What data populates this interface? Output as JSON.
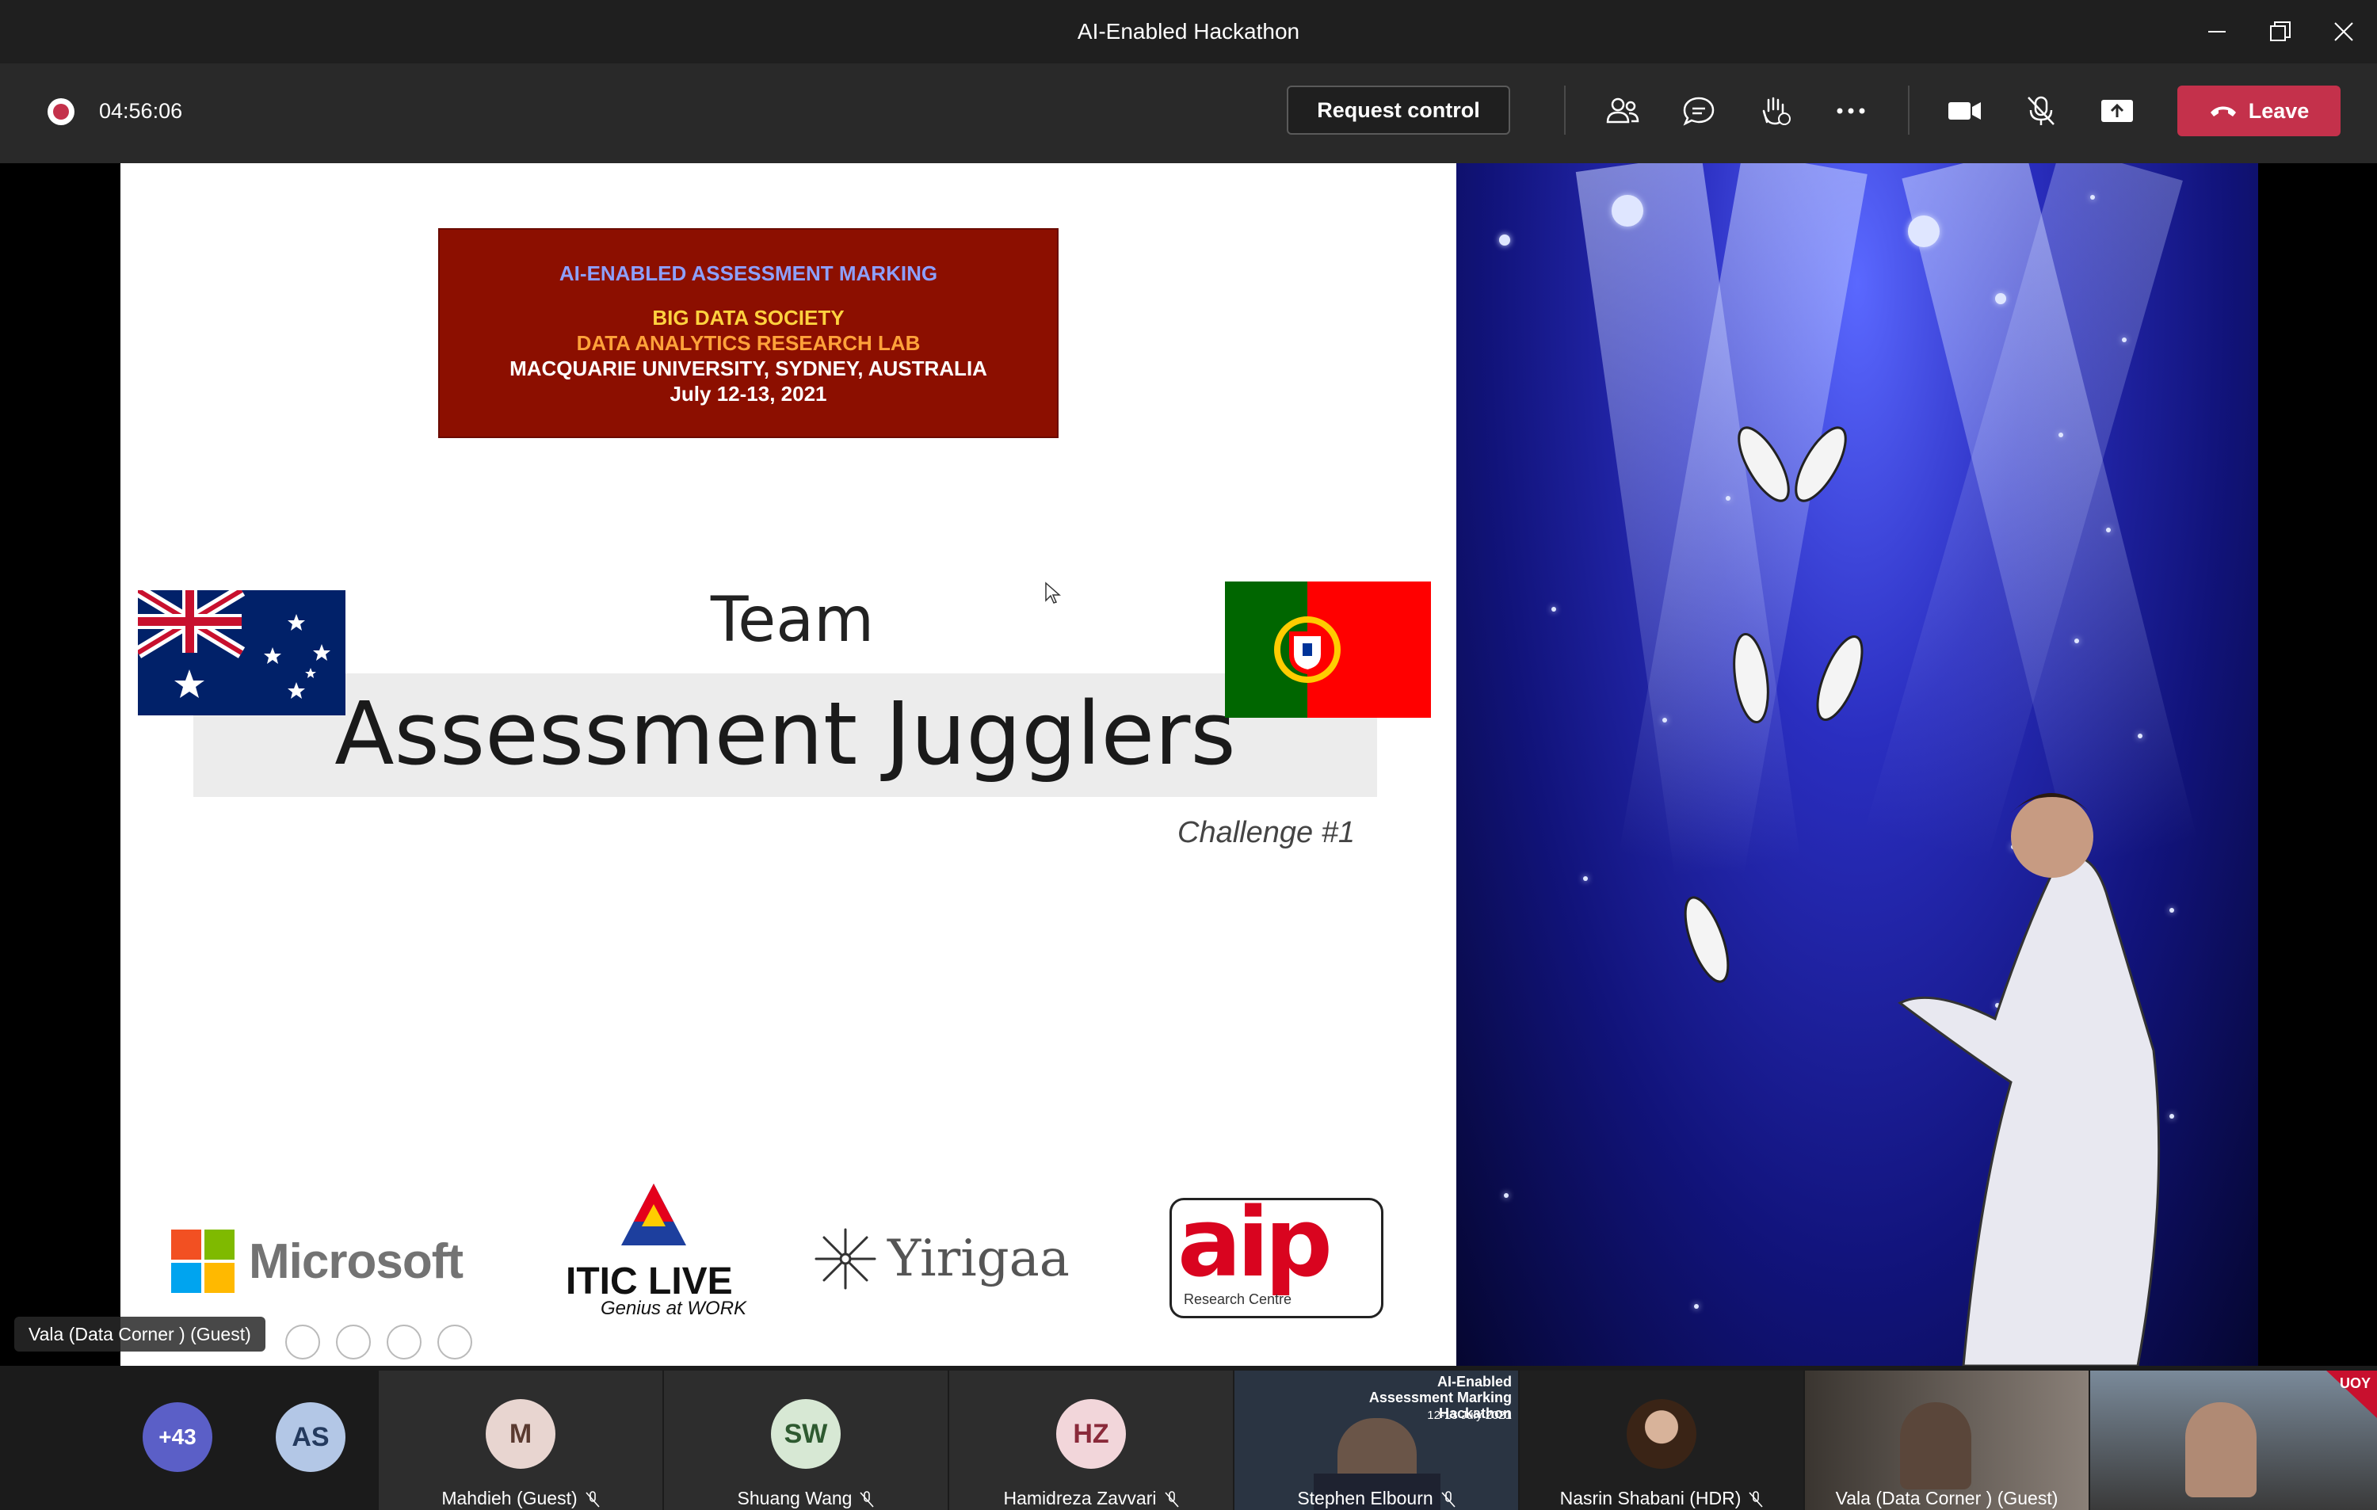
{
  "window": {
    "title": "AI-Enabled Hackathon",
    "controls": [
      "minimize-icon",
      "restore-icon",
      "close-icon"
    ]
  },
  "toolbar": {
    "timer": "04:56:06",
    "request_control_label": "Request control",
    "icons": [
      "people-icon",
      "chat-icon",
      "raise-hand-icon",
      "more-options-icon",
      "camera-icon",
      "mic-off-icon",
      "share-screen-icon"
    ],
    "leave_label": "Leave"
  },
  "slide": {
    "banner": {
      "line1": "AI-ENABLED ASSESSMENT MARKING",
      "line2": "BIG DATA SOCIETY",
      "line3": "DATA ANALYTICS RESEARCH LAB",
      "line4": "MACQUARIE UNIVERSITY, SYDNEY, AUSTRALIA",
      "line5": "July 12-13, 2021"
    },
    "team_label": "Team",
    "team_name": "Assessment Jugglers",
    "challenge": "Challenge #1",
    "logos": {
      "microsoft": "Microsoft",
      "itic": "ITIC LIVE",
      "itic_tagline": "Genius at WORK",
      "yirigaa": "Yirigaa",
      "aip": "aip",
      "aip_sub": "Research Centre"
    }
  },
  "presenter_label": "Vala (Data Corner ) (Guest)",
  "participants": [
    {
      "initials": "+43",
      "name": "",
      "color": "#5b5fc7",
      "muted": false
    },
    {
      "initials": "AS",
      "name": "",
      "color": "#b3c7e6",
      "muted": false
    },
    {
      "initials": "M",
      "name": "Mahdieh (Guest)",
      "color": "#e8d5d0",
      "muted": true
    },
    {
      "initials": "SW",
      "name": "Shuang Wang",
      "color": "#d7e8d4",
      "muted": true
    },
    {
      "initials": "HZ",
      "name": "Hamidreza Zavvari",
      "color": "#f2d6da",
      "muted": true
    },
    {
      "initials": "",
      "name": "Stephen Elbourn",
      "video_caption": "AI-Enabled Assessment Marking Hackathon",
      "video_caption2": "12-13 July 2021",
      "muted": true
    },
    {
      "initials": "",
      "name": "Nasrin Shabani (HDR)",
      "muted": true
    },
    {
      "initials": "",
      "name": "Vala (Data Corner ) (Guest)",
      "muted": false
    },
    {
      "initials": "",
      "name": "",
      "badge": "UOY",
      "muted": false
    }
  ],
  "colors": {
    "leave": "#c4314b",
    "toolbar": "#292929",
    "banner": "#8c0f00"
  }
}
